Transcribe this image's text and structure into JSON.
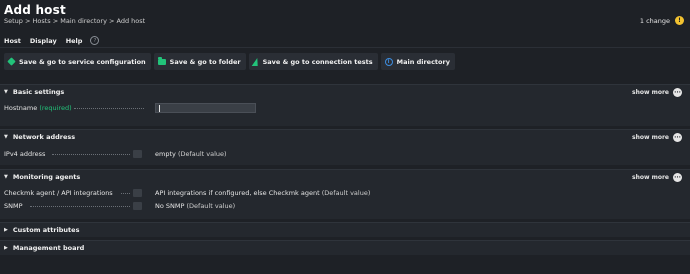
{
  "header": {
    "title": "Add host",
    "breadcrumb": "Setup > Hosts > Main directory > Add host",
    "changes": "1 change",
    "changes_icon": "!"
  },
  "menu": {
    "items": [
      "Host",
      "Display",
      "Help"
    ],
    "help_icon": "?"
  },
  "toolbar": {
    "buttons": [
      {
        "label": "Save & go to service configuration",
        "icon": "cube-icon"
      },
      {
        "label": "Save & go to folder",
        "icon": "folder-icon"
      },
      {
        "label": "Save & go to connection tests",
        "icon": "bolt-icon"
      },
      {
        "label": "Main directory",
        "icon": "info-icon"
      }
    ]
  },
  "sections": {
    "basic": {
      "title": "Basic settings",
      "show_more": "show more",
      "hostname_label": "Hostname",
      "hostname_required": "(required)",
      "hostname_value": ""
    },
    "network": {
      "title": "Network address",
      "show_more": "show more",
      "ipv4_label": "IPv4 address",
      "ipv4_value": "empty",
      "ipv4_default": "(Default value)"
    },
    "monitoring": {
      "title": "Monitoring agents",
      "show_more": "show more",
      "agent_label": "Checkmk agent / API integrations",
      "agent_value": "API integrations if configured, else Checkmk agent",
      "agent_default": "(Default value)",
      "snmp_label": "SNMP",
      "snmp_value": "No SNMP",
      "snmp_default": "(Default value)"
    },
    "custom": {
      "title": "Custom attributes"
    },
    "management": {
      "title": "Management board"
    }
  },
  "colors": {
    "background": "#1e2126",
    "section": "#24282e",
    "accent_green": "#22c37a",
    "warning": "#f2c230",
    "info_blue": "#3d8ee0"
  }
}
